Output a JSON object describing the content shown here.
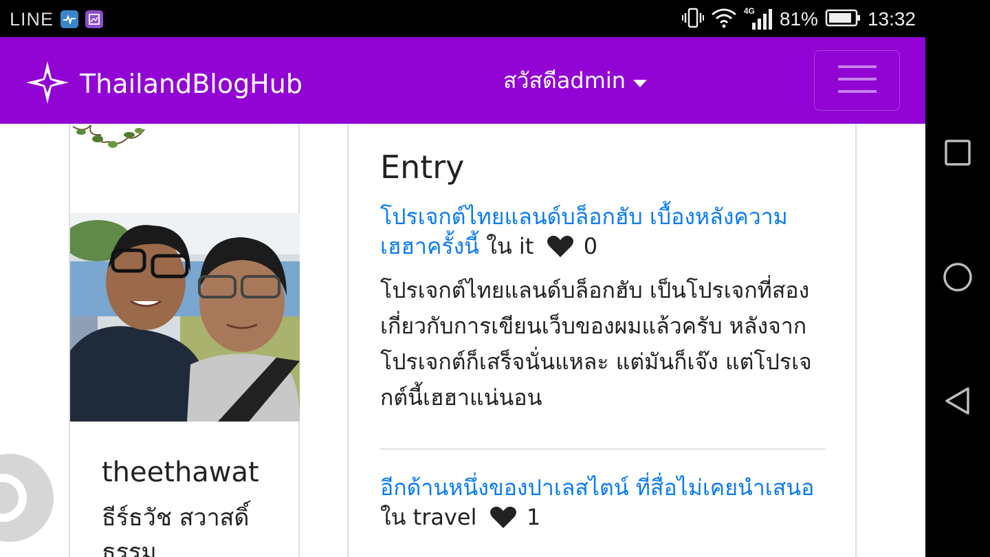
{
  "status_bar": {
    "app_name": "LINE",
    "network": "4G",
    "battery_percent": "81%",
    "time": "13:32"
  },
  "header": {
    "brand": "ThailandBlogHub",
    "greeting": "สวัสดีadmin"
  },
  "profile": {
    "username": "theethawat",
    "full_name": "ธีร์ธวัช สวาสดิ์ธรรม"
  },
  "entries_section": {
    "heading": "Entry",
    "in_word": "ใน",
    "entries": [
      {
        "title": "โปรเจกต์ไทยแลนด์บล็อกฮับ เบื้องหลังความเฮฮาครั้งนี้",
        "category": "it",
        "likes": "0",
        "excerpt": "โปรเจกต์ไทยแลนด์บล็อกฮับ เป็นโปรเจกที่สองเกี่ยวกับการเขียนเว็บของผมแล้วครับ หลังจากโปรเจกต์ก็เสร็จนั่นแหละ แต่มันก็เจ๊ง แต่โปรเจกต์นี้เฮฮาแน่นอน"
      },
      {
        "title": "อีกด้านหนึ่งของปาเลสไตน์ ที่สื่อไม่เคยนำเสนอ",
        "category": "travel",
        "likes": "1",
        "excerpt": ""
      }
    ]
  },
  "colors": {
    "header_bg": "#9104d4",
    "link": "#0a7bf2",
    "text": "#222222"
  },
  "icons": {
    "brand": "compass-star-icon",
    "heart": "heart-icon",
    "menu": "hamburger-menu-icon"
  }
}
